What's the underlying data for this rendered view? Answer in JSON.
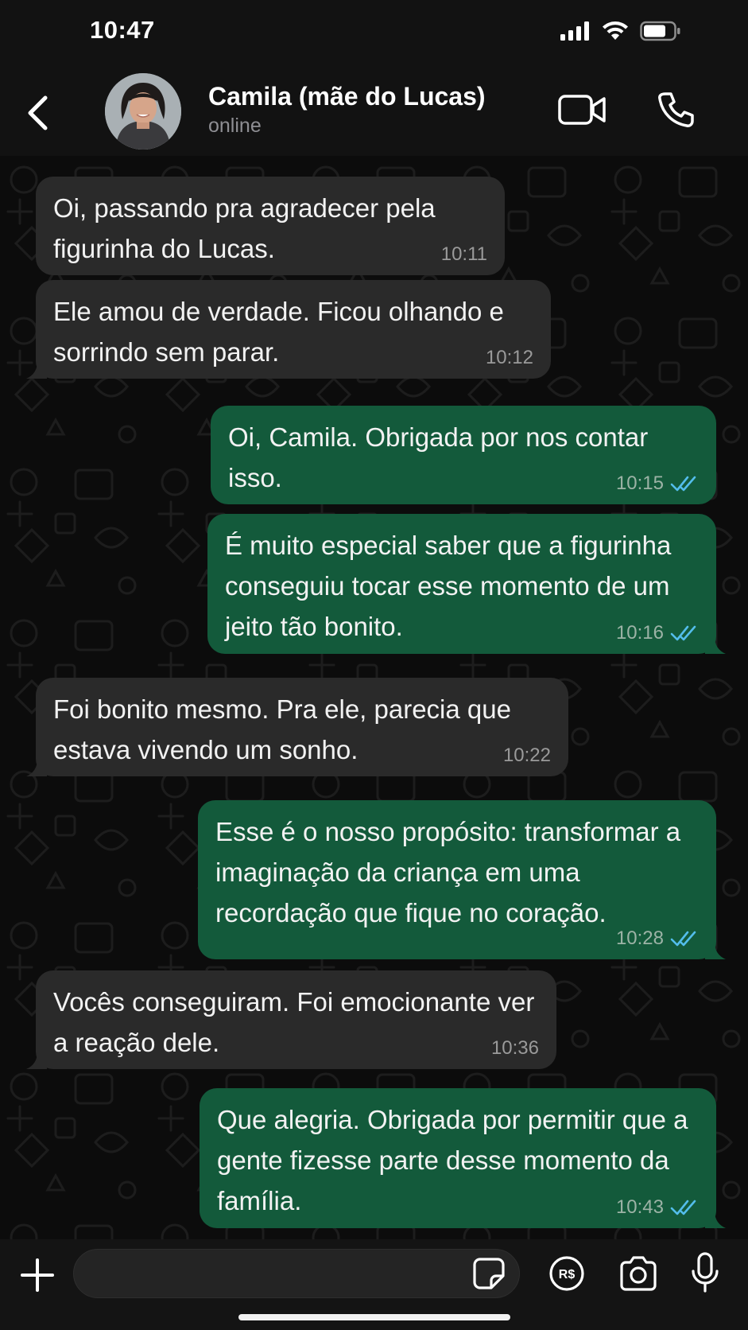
{
  "status_bar": {
    "time": "10:47"
  },
  "header": {
    "contact_name": "Camila (mãe do Lucas)",
    "contact_status": "online"
  },
  "messages": [
    {
      "direction": "in",
      "text": "Oi, passando pra agradecer pela figurinha do Lucas.",
      "time": "10:11"
    },
    {
      "direction": "in",
      "text": "Ele amou de verdade. Ficou olhando e sorrindo sem parar.",
      "time": "10:12"
    },
    {
      "direction": "out",
      "text": "Oi, Camila. Obrigada por nos contar isso.",
      "time": "10:15",
      "read": true
    },
    {
      "direction": "out",
      "text": "É muito especial saber que a figurinha conseguiu tocar esse momento de um jeito tão bonito.",
      "time": "10:16",
      "read": true
    },
    {
      "direction": "in",
      "text": "Foi bonito mesmo. Pra ele, parecia que estava vivendo um sonho.",
      "time": "10:22"
    },
    {
      "direction": "out",
      "text": "Esse é o nosso propósito: transformar a imaginação da criança em uma recordação que fique no coração.",
      "time": "10:28",
      "read": true
    },
    {
      "direction": "in",
      "text": "Vocês conseguiram. Foi emocionante ver a reação dele.",
      "time": "10:36"
    },
    {
      "direction": "out",
      "text": "Que alegria. Obrigada por permitir que a gente fizesse parte desse momento da família.",
      "time": "10:43",
      "read": true
    }
  ],
  "input_bar": {
    "placeholder": "",
    "pix_label": "R$"
  },
  "colors": {
    "incoming_bubble": "#2a2a2a",
    "outgoing_bubble": "#135a3b",
    "read_ticks": "#53bdeb",
    "background": "#0b0b0b"
  },
  "icons": [
    "signal-icon",
    "wifi-icon",
    "battery-icon",
    "back-chevron-icon",
    "video-call-icon",
    "phone-icon",
    "plus-icon",
    "sticker-icon",
    "pix-icon",
    "camera-icon",
    "mic-icon",
    "double-check-icon"
  ]
}
